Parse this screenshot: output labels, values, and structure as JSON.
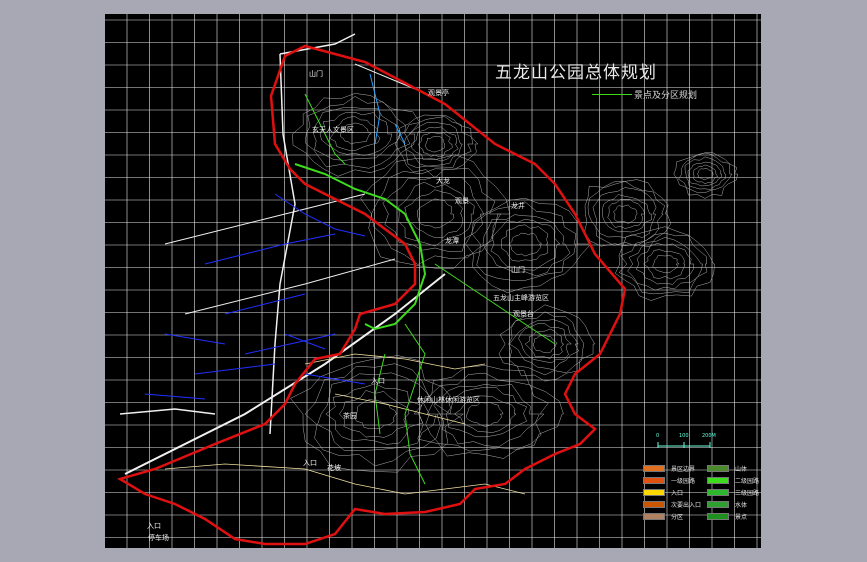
{
  "title": "五龙山公园总体规划",
  "subtitle": "景点及分区规划",
  "colors": {
    "background": "#000000",
    "grid": "#e8e8e8",
    "boundary": "#e01010",
    "contour": "#b0b0b0",
    "paths": "#3ddc1d",
    "roads": "#f0f0f0",
    "water": "#2030ff",
    "trails": "#f0e0a0"
  },
  "zone_labels": {
    "z1": "玄天人文景区",
    "z2": "五龙山主峰游览区",
    "z3": "休闲山林休闲游览区"
  },
  "map_labels": {
    "l1": "山门",
    "l2": "观景亭",
    "l3": "大龙",
    "l4": "观景",
    "l5": "龙井",
    "l6": "龙潭",
    "l7": "山门",
    "l8": "观景台",
    "l9": "入口",
    "l10": "入口",
    "l11": "茶园",
    "l12": "花坡",
    "l13": "入口",
    "l14": "停车场"
  },
  "scale": {
    "label_a": "0",
    "label_b": "100",
    "label_c": "200M"
  },
  "legend": [
    {
      "label": "景区边界",
      "color": "#e07020"
    },
    {
      "label": "一级园路",
      "color": "#e05010"
    },
    {
      "label": "入口",
      "color": "#ffd700"
    },
    {
      "label": "次要出入口",
      "color": "#cc5500"
    },
    {
      "label": "分区",
      "color": "#b08060"
    },
    {
      "label": "山体",
      "color": "#4a8a2a"
    },
    {
      "label": "二级园路",
      "color": "#3ddc1d"
    },
    {
      "label": "三级园路",
      "color": "#2eb82e"
    },
    {
      "label": "水体",
      "color": "#2fa02f"
    },
    {
      "label": "景点",
      "color": "#1e901e"
    }
  ]
}
